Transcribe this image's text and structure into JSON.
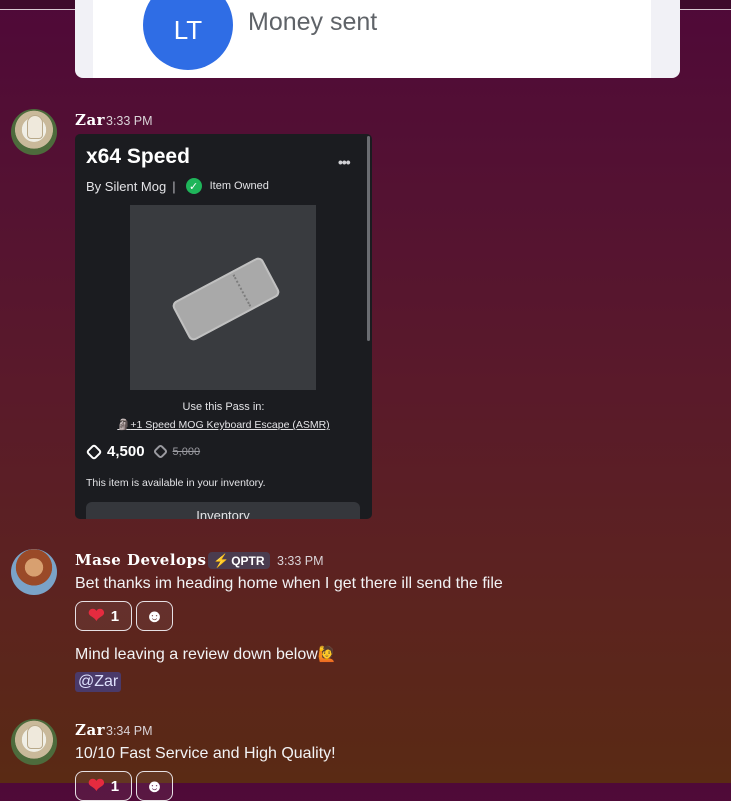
{
  "top_card": {
    "avatar_initials": "LT",
    "text": "Money sent"
  },
  "messages": [
    {
      "username": "Zar",
      "timestamp": "3:33 PM",
      "embed": {
        "title": "x64 Speed",
        "by_prefix": "By",
        "creator": "Silent Mog",
        "owned_label": "Item Owned",
        "use_pass_label": "Use this Pass in:",
        "game_link": "+1 Speed MOG Keyboard Escape (ASMR)",
        "price": "4,500",
        "old_price": "5,000",
        "availability": "This item is available in your inventory.",
        "inventory_button": "Inventory"
      }
    },
    {
      "username": "Mase Develops",
      "badge": "QPTR",
      "timestamp": "3:33 PM",
      "text": "Bet thanks im heading home when I get there ill send the file",
      "reaction_count": "1",
      "followup_text": "Mind leaving a review down below",
      "mention": "@Zar"
    },
    {
      "username": "Zar",
      "timestamp": "3:34 PM",
      "text": "10/10 Fast Service and High Quality!",
      "reaction_count": "1"
    }
  ],
  "colors": {
    "reaction_heart": "#e52b3f",
    "owned_check": "#1fb55a",
    "mention_bg": "#4a3a6a"
  }
}
